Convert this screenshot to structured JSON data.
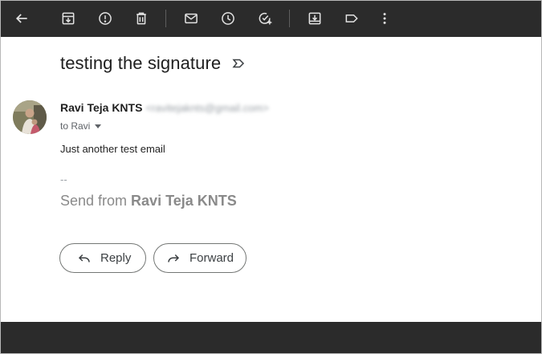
{
  "toolbar": {
    "icons": [
      "back-arrow-icon",
      "archive-icon",
      "report-spam-icon",
      "delete-icon",
      "mark-unread-icon",
      "snooze-icon",
      "add-to-tasks-icon",
      "move-to-icon",
      "labels-icon",
      "more-options-icon"
    ]
  },
  "email": {
    "subject": "testing the signature",
    "sender_name": "Ravi Teja KNTS",
    "sender_email": "<ravitejaknts@gmail.com>",
    "to_label": "to Ravi",
    "body": "Just another test email",
    "signature_dash": "--",
    "signature_prefix": "Send from ",
    "signature_name": "Ravi Teja KNTS"
  },
  "actions": {
    "reply_label": "Reply",
    "forward_label": "Forward"
  },
  "colors": {
    "toolbar_bg": "#2b2b2b",
    "icon": "#e3e3e3",
    "subject_text": "#1f1f1f",
    "signature_text": "#8a8a8a"
  }
}
